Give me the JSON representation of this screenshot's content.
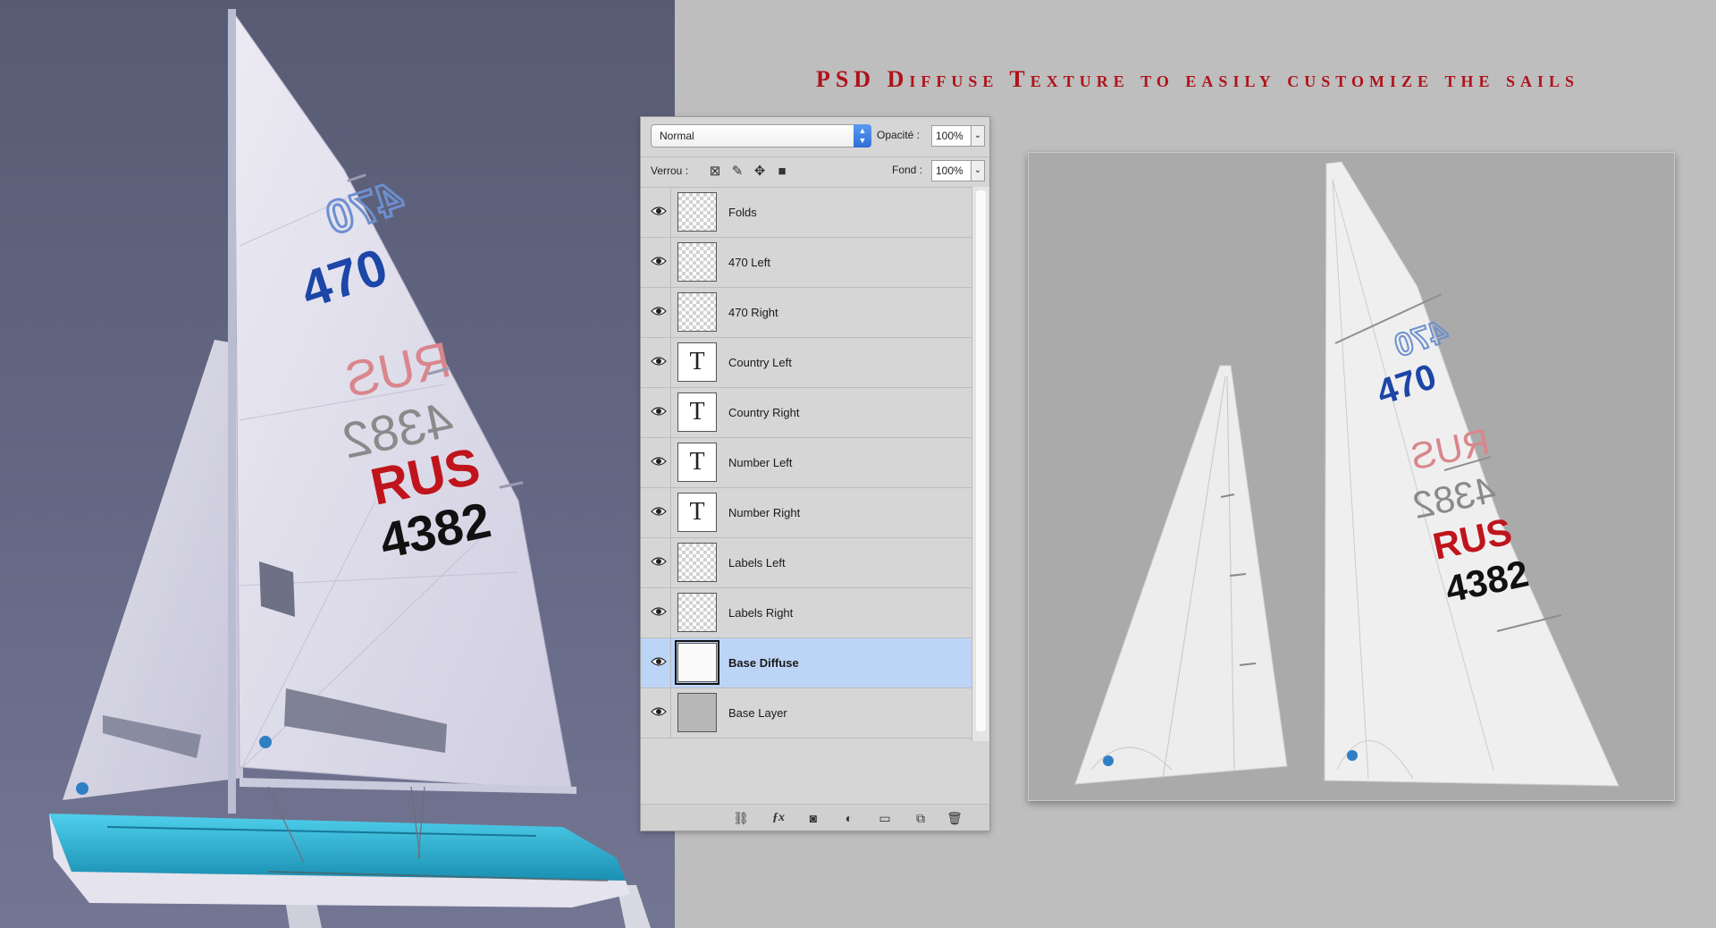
{
  "headline": "PSD Diffuse Texture to easily customize the sails",
  "sail_graphics": {
    "class_logo": "470",
    "country": "RUS",
    "sail_number": "4382",
    "colors": {
      "logo_blue": "#1c46a8",
      "country_red": "#c0141c",
      "number_black": "#111111",
      "mirror_gray": "#8a8a8a",
      "mirror_pink": "#d9868c",
      "hull_cyan": "#36b6d6"
    }
  },
  "layers_panel": {
    "blend_mode": "Normal",
    "opacity_label": "Opacité :",
    "opacity_value": "100%",
    "lock_label": "Verrou :",
    "fill_label": "Fond :",
    "fill_value": "100%",
    "layers": [
      {
        "name": "Folds",
        "thumb": "transparent",
        "visible": true,
        "selected": false
      },
      {
        "name": "470 Left",
        "thumb": "transparent",
        "visible": true,
        "selected": false
      },
      {
        "name": "470 Right",
        "thumb": "transparent",
        "visible": true,
        "selected": false
      },
      {
        "name": "Country Left",
        "thumb": "text",
        "visible": true,
        "selected": false
      },
      {
        "name": "Country Right",
        "thumb": "text",
        "visible": true,
        "selected": false
      },
      {
        "name": "Number Left",
        "thumb": "text",
        "visible": true,
        "selected": false
      },
      {
        "name": "Number Right",
        "thumb": "text",
        "visible": true,
        "selected": false
      },
      {
        "name": "Labels Left",
        "thumb": "transparent",
        "visible": true,
        "selected": false
      },
      {
        "name": "Labels Right",
        "thumb": "transparent",
        "visible": true,
        "selected": false
      },
      {
        "name": "Base Diffuse",
        "thumb": "base",
        "visible": true,
        "selected": true
      },
      {
        "name": "Base Layer",
        "thumb": "solid",
        "visible": true,
        "selected": false
      }
    ],
    "text_thumb_glyph": "T",
    "footer_icons": [
      "link-icon",
      "fx-icon",
      "mask-icon",
      "adjustment-icon",
      "folder-icon",
      "new-layer-icon",
      "trash-icon"
    ]
  }
}
